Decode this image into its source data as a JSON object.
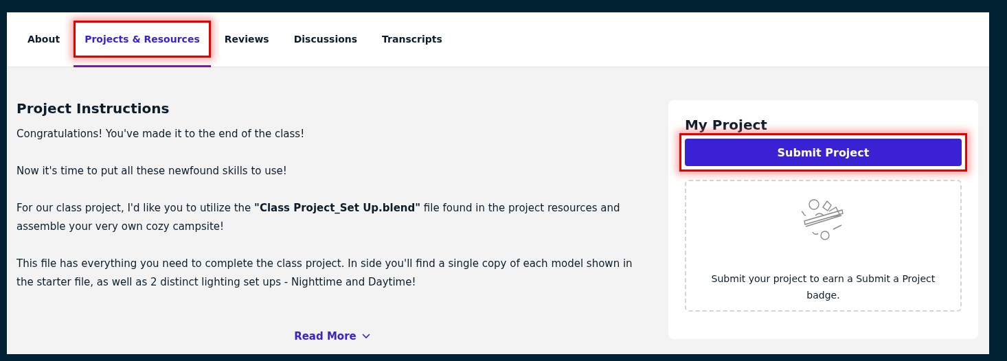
{
  "tabs": [
    {
      "label": "About",
      "selected": false,
      "highlighted": false
    },
    {
      "label": "Projects & Resources",
      "selected": true,
      "highlighted": true
    },
    {
      "label": "Reviews",
      "selected": false,
      "highlighted": false
    },
    {
      "label": "Discussions",
      "selected": false,
      "highlighted": false
    },
    {
      "label": "Transcripts",
      "selected": false,
      "highlighted": false
    }
  ],
  "instructions": {
    "title": "Project Instructions",
    "paragraphs": [
      "Congratulations! You've made it to the end of the class!",
      "Now it's time to put all these newfound skills to use!",
      "For our class project, I'd like you to utilize the **\"Class Project_Set Up.blend\"** file found in the project resources and assemble your very own cozy campsite!",
      "This file has everything you need to complete the class project. In side you'll find a single copy of each model shown in the starter file, as well as 2 distinct lighting set ups - Nighttime and Daytime!"
    ],
    "read_more": "Read More"
  },
  "my_project": {
    "title": "My Project",
    "button": {
      "label": "Submit Project",
      "highlighted": true
    },
    "empty_text": "Submit your project to earn a Submit a Project badge."
  }
}
